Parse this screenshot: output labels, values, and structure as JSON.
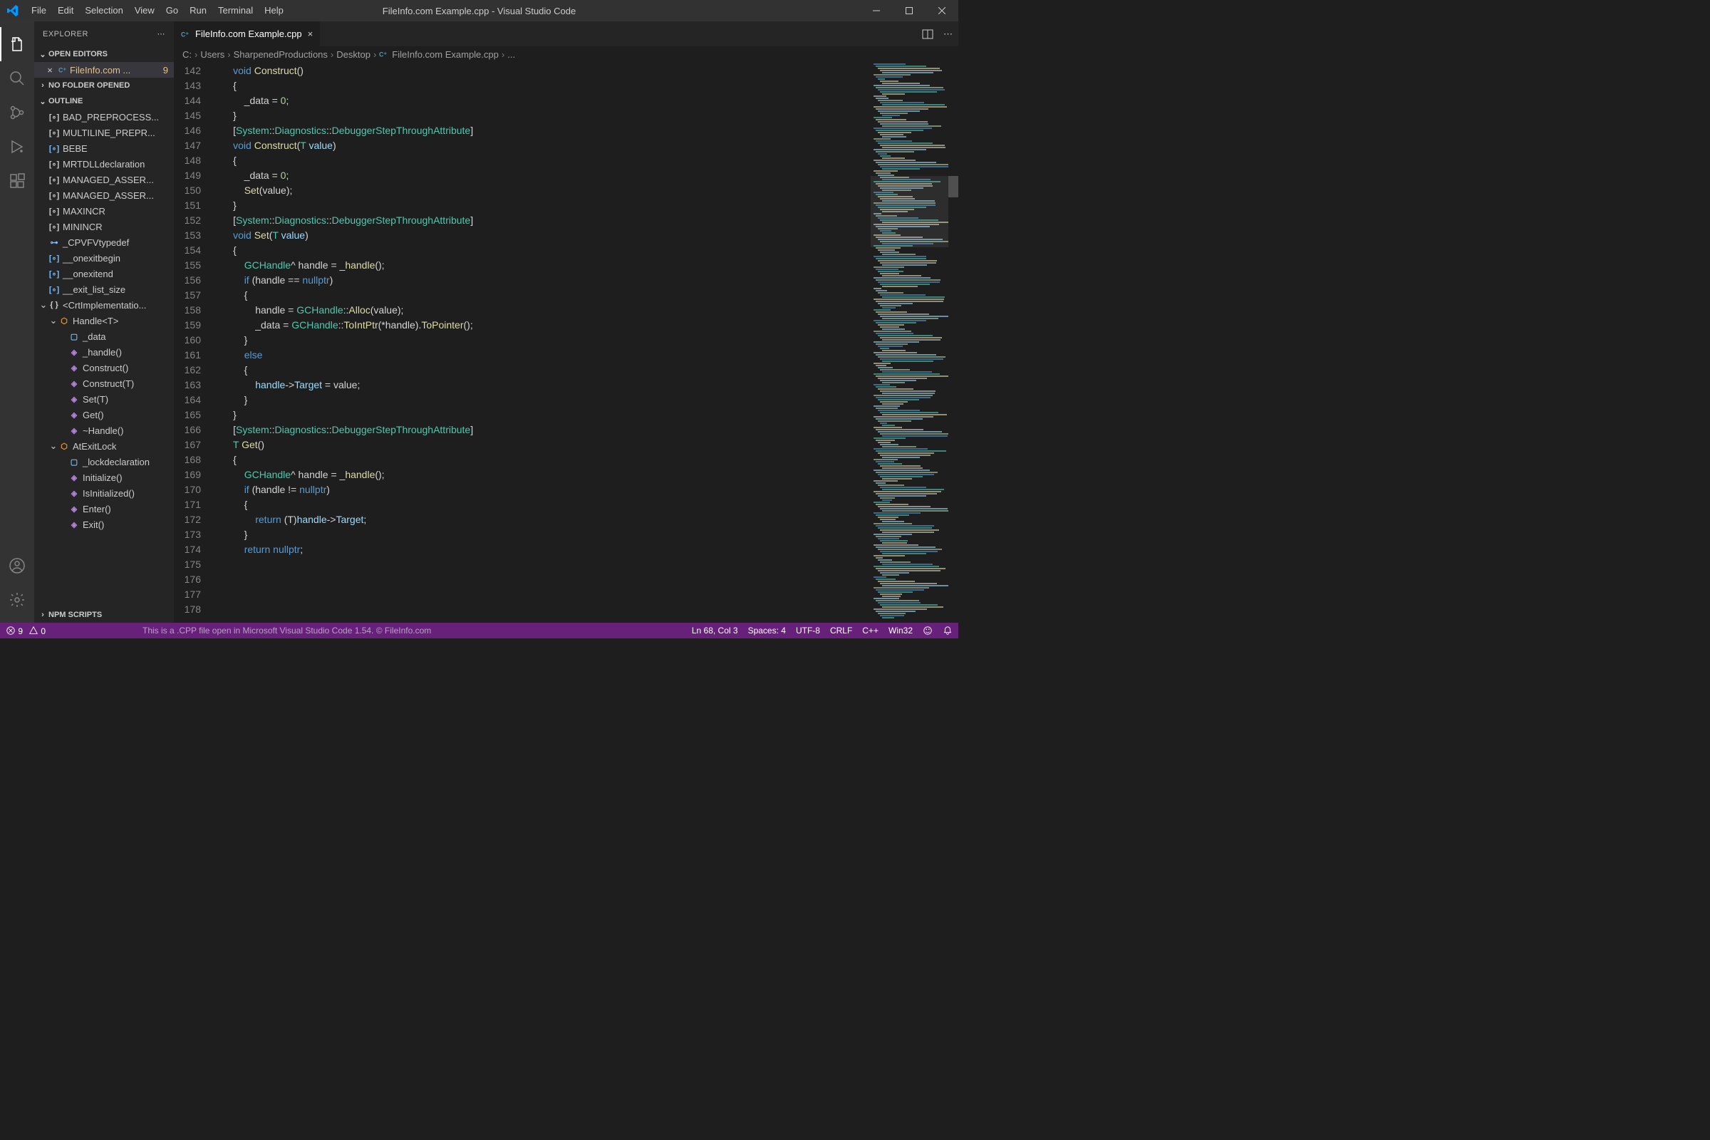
{
  "window": {
    "title": "FileInfo.com Example.cpp - Visual Studio Code"
  },
  "menu": [
    "File",
    "Edit",
    "Selection",
    "View",
    "Go",
    "Run",
    "Terminal",
    "Help"
  ],
  "sidebar": {
    "title": "EXPLORER",
    "sections": {
      "openEditors": "OPEN EDITORS",
      "noFolder": "NO FOLDER OPENED",
      "outline": "OUTLINE",
      "npm": "NPM SCRIPTS"
    },
    "openFile": {
      "name": "FileInfo.com ...",
      "badge": "9"
    },
    "outline": [
      {
        "depth": 0,
        "kind": "constant",
        "label": "BAD_PREPROCESS..."
      },
      {
        "depth": 0,
        "kind": "constant",
        "label": "MULTILINE_PREPR..."
      },
      {
        "depth": 0,
        "kind": "variable",
        "label": "BEBE"
      },
      {
        "depth": 0,
        "kind": "constant",
        "label": "MRTDLL",
        "detail": "declaration"
      },
      {
        "depth": 0,
        "kind": "constant",
        "label": "MANAGED_ASSER..."
      },
      {
        "depth": 0,
        "kind": "constant",
        "label": "MANAGED_ASSER..."
      },
      {
        "depth": 0,
        "kind": "constant",
        "label": "MAXINCR"
      },
      {
        "depth": 0,
        "kind": "constant",
        "label": "MININCR"
      },
      {
        "depth": 0,
        "kind": "typedef",
        "label": "_CPVFV",
        "detail": "typedef"
      },
      {
        "depth": 0,
        "kind": "variable",
        "label": "__onexitbegin"
      },
      {
        "depth": 0,
        "kind": "variable",
        "label": "__onexitend"
      },
      {
        "depth": 0,
        "kind": "variable",
        "label": "__exit_list_size"
      },
      {
        "depth": 0,
        "kind": "namespace",
        "label": "<CrtImplementatio...",
        "chev": true
      },
      {
        "depth": 1,
        "kind": "class",
        "label": "Handle<T>",
        "chev": true
      },
      {
        "depth": 2,
        "kind": "field",
        "label": "_data"
      },
      {
        "depth": 2,
        "kind": "method",
        "label": "_handle()"
      },
      {
        "depth": 2,
        "kind": "method",
        "label": "Construct()"
      },
      {
        "depth": 2,
        "kind": "method",
        "label": "Construct(T)"
      },
      {
        "depth": 2,
        "kind": "method",
        "label": "Set(T)"
      },
      {
        "depth": 2,
        "kind": "method",
        "label": "Get()"
      },
      {
        "depth": 2,
        "kind": "method",
        "label": "~Handle()"
      },
      {
        "depth": 1,
        "kind": "class",
        "label": "AtExitLock",
        "chev": true
      },
      {
        "depth": 2,
        "kind": "field",
        "label": "_lock",
        "detail": "declaration"
      },
      {
        "depth": 2,
        "kind": "method",
        "label": "Initialize()"
      },
      {
        "depth": 2,
        "kind": "method",
        "label": "IsInitialized()"
      },
      {
        "depth": 2,
        "kind": "method",
        "label": "Enter()"
      },
      {
        "depth": 2,
        "kind": "method",
        "label": "Exit()"
      }
    ]
  },
  "tab": {
    "name": "FileInfo.com Example.cpp"
  },
  "breadcrumbs": [
    "C:",
    "Users",
    "SharpenedProductions",
    "Desktop",
    "FileInfo.com Example.cpp",
    "..."
  ],
  "code": {
    "startLine": 142,
    "lines": [
      "",
      "        <kw>void</kw> <fn>Construct</fn>()",
      "        {",
      "            _data = <num>0</num>;",
      "        }",
      "",
      "        [<type>System</type>::<type>Diagnostics</type>::<type>DebuggerStepThroughAttribute</type>]",
      "        <kw>void</kw> <fn>Construct</fn>(<type>T</type> <field>value</field>)",
      "        {",
      "            _data = <num>0</num>;",
      "            <fn>Set</fn>(value);",
      "        }",
      "",
      "        [<type>System</type>::<type>Diagnostics</type>::<type>DebuggerStepThroughAttribute</type>]",
      "        <kw>void</kw> <fn>Set</fn>(<type>T</type> <field>value</field>)",
      "        {",
      "            <type>GCHandle</type>^ handle = <fn>_handle</fn>();",
      "            <kw>if</kw> (handle == <kw>nullptr</kw>)",
      "            {",
      "                handle = <type>GCHandle</type>::<fn>Alloc</fn>(value);",
      "                _data = <type>GCHandle</type>::<fn>ToIntPtr</fn>(*handle).<fn>ToPointer</fn>();",
      "            }",
      "            <kw>else</kw>",
      "            {",
      "                <field>handle</field>-><field>Target</field> = value;",
      "            }",
      "        }",
      "",
      "        [<type>System</type>::<type>Diagnostics</type>::<type>DebuggerStepThroughAttribute</type>]",
      "        <type>T</type> <fn>Get</fn>()",
      "        {",
      "            <type>GCHandle</type>^ handle = <fn>_handle</fn>();",
      "            <kw>if</kw> (handle != <kw>nullptr</kw>)",
      "            {",
      "                <kw>return</kw> (T)<field>handle</field>-><field>Target</field>;",
      "            }",
      "            <kw>return</kw> <kw>nullptr</kw>;"
    ]
  },
  "status": {
    "errors": "9",
    "warnings": "0",
    "message": "This is a .CPP file open in Microsoft Visual Studio Code 1.54. © FileInfo.com",
    "pos": "Ln 68, Col 3",
    "spaces": "Spaces: 4",
    "encoding": "UTF-8",
    "eol": "CRLF",
    "lang": "C++",
    "platform": "Win32"
  }
}
